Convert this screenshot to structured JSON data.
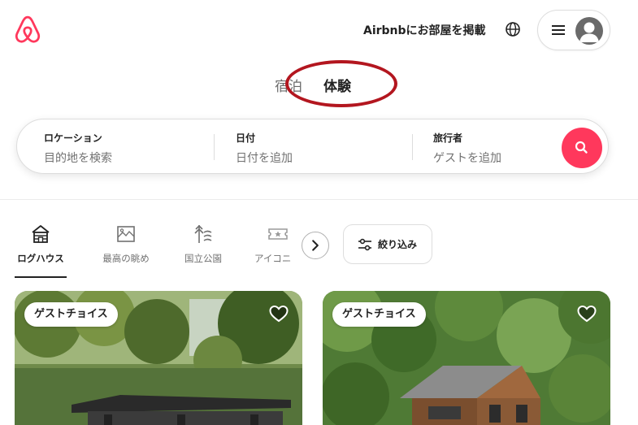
{
  "header": {
    "logo_icon": "airbnb-logo-icon",
    "host_link": "Airbnbにお部屋を掲載",
    "globe_icon": "globe-icon",
    "menu_icon": "hamburger-icon",
    "avatar_icon": "user-avatar-icon"
  },
  "tabs": [
    {
      "label": "宿泊",
      "active": false
    },
    {
      "label": "体験",
      "active": true
    }
  ],
  "search": {
    "location": {
      "label": "ロケーション",
      "placeholder": "目的地を検索"
    },
    "dates": {
      "label": "日付",
      "placeholder": "日付を追加"
    },
    "guests": {
      "label": "旅行者",
      "placeholder": "ゲストを追加"
    },
    "button_icon": "search-icon"
  },
  "categories": [
    {
      "label": "ログハウス",
      "icon": "cabin-icon",
      "active": true
    },
    {
      "label": "最高の眺め",
      "icon": "view-icon",
      "active": false
    },
    {
      "label": "国立公園",
      "icon": "national-park-icon",
      "active": false
    },
    {
      "label": "アイコニ",
      "icon": "ticket-icon",
      "active": false
    }
  ],
  "scroll_next_icon": "chevron-right-icon",
  "filter": {
    "label": "絞り込み",
    "icon": "filter-icon"
  },
  "listings": [
    {
      "badge": "ゲストチョイス",
      "favorite_icon": "heart-icon"
    },
    {
      "badge": "ゲストチョイス",
      "favorite_icon": "heart-icon"
    }
  ],
  "colors": {
    "brand": "#ff385c",
    "annotation_ring": "#b3161f",
    "text_primary": "#222222",
    "text_secondary": "#717171"
  }
}
